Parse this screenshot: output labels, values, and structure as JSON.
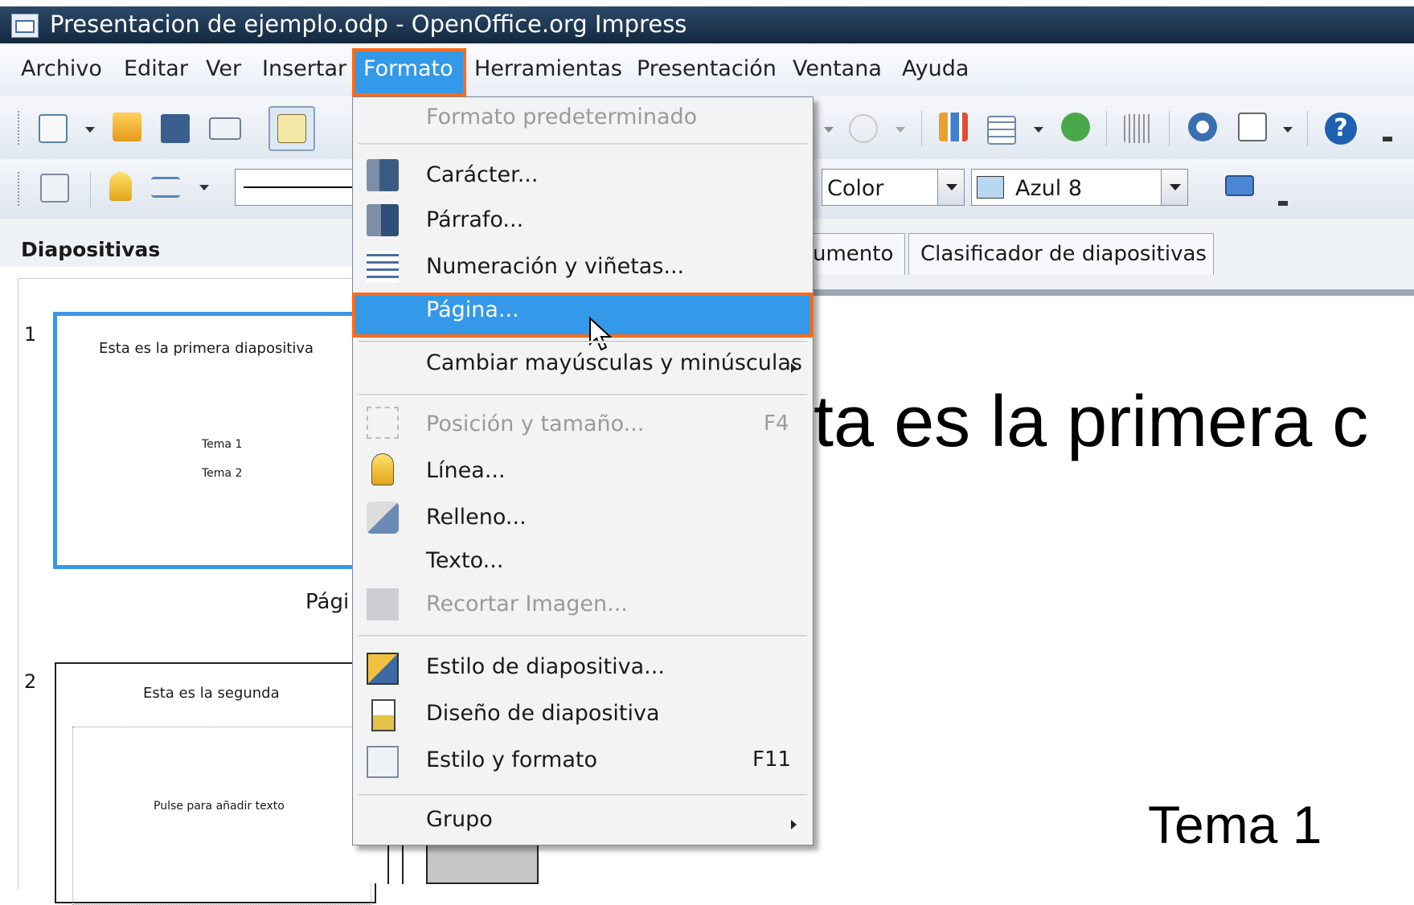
{
  "window": {
    "title": "Presentacion de ejemplo.odp - OpenOffice.org Impress"
  },
  "menubar": {
    "items": [
      "Archivo",
      "Editar",
      "Ver",
      "Insertar",
      "Formato",
      "Herramientas",
      "Presentación",
      "Ventana",
      "Ayuda"
    ],
    "active": "Formato"
  },
  "toolbar2": {
    "area_style": "Color",
    "area_color": "Azul 8"
  },
  "slides_pane": {
    "title": "Diapositivas",
    "slides": [
      {
        "number": "1",
        "title": "Esta es la primera diapositiva",
        "items": [
          "Tema 1",
          "Tema 2"
        ],
        "caption": "Pági"
      },
      {
        "number": "2",
        "title": "Esta es la segunda",
        "placeholder": "Pulse para añadir texto"
      }
    ]
  },
  "tabs": {
    "partial": "umento",
    "sorter": "Clasificador de diapositivas"
  },
  "slide": {
    "title_visible": "ta es la primera c",
    "bullet": "Tema 1"
  },
  "format_menu": {
    "items": [
      {
        "label": "Formato predeterminado",
        "disabled": true
      },
      {
        "label": "Carácter...",
        "icon": "character-icon"
      },
      {
        "label": "Párrafo...",
        "icon": "paragraph-icon"
      },
      {
        "label": "Numeración y viñetas...",
        "icon": "bullets-icon"
      },
      {
        "label": "Página...",
        "highlighted": true
      },
      {
        "label": "Cambiar mayúsculas y minúsculas",
        "submenu": true
      },
      {
        "label": "Posición y tamaño...",
        "shortcut": "F4",
        "disabled": true,
        "icon": "position-size-icon"
      },
      {
        "label": "Línea...",
        "icon": "line-icon"
      },
      {
        "label": "Relleno...",
        "icon": "fill-icon"
      },
      {
        "label": "Texto..."
      },
      {
        "label": "Recortar Imagen...",
        "disabled": true,
        "icon": "crop-icon"
      },
      {
        "label": "Estilo de diapositiva...",
        "icon": "slide-style-icon"
      },
      {
        "label": "Diseño de diapositiva",
        "icon": "slide-layout-icon"
      },
      {
        "label": "Estilo y formato",
        "shortcut": "F11",
        "icon": "styles-icon"
      },
      {
        "label": "Grupo",
        "submenu": true
      }
    ]
  },
  "colors": {
    "accent": "#3399e8",
    "highlight_border": "#ff6a1a",
    "titlebar": "#1c3650"
  }
}
